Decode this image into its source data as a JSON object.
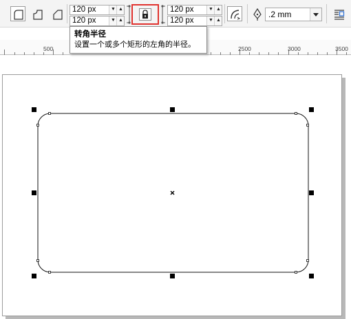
{
  "toolbar": {
    "corner_buttons": [
      {
        "icon": "round-corner-icon",
        "active": true
      },
      {
        "icon": "scalloped-corner-icon",
        "active": false
      },
      {
        "icon": "chamfered-corner-icon",
        "active": false
      }
    ],
    "left_fields": {
      "top": "120 px",
      "bottom": "120 px"
    },
    "right_fields": {
      "top": "120 px",
      "bottom": "120 px"
    },
    "lock_icon": "lock-icon",
    "relative_corner_icon": "relative-corner-scaling-icon",
    "outline_icon": "pen-nib-icon",
    "outline_width": ".2 mm",
    "wrap_text_icon": "wrap-text-icon"
  },
  "tooltip": {
    "title": "转角半径",
    "body": "设置一个或多个矩形的左角的半径。"
  },
  "ruler": {
    "labels": [
      "500",
      "2500",
      "3000",
      "3500"
    ]
  },
  "colors": {
    "highlight_border": "#e0322e",
    "toolbar_bg": "#f4f4f4",
    "page_shadow": "#b8b8b8"
  }
}
